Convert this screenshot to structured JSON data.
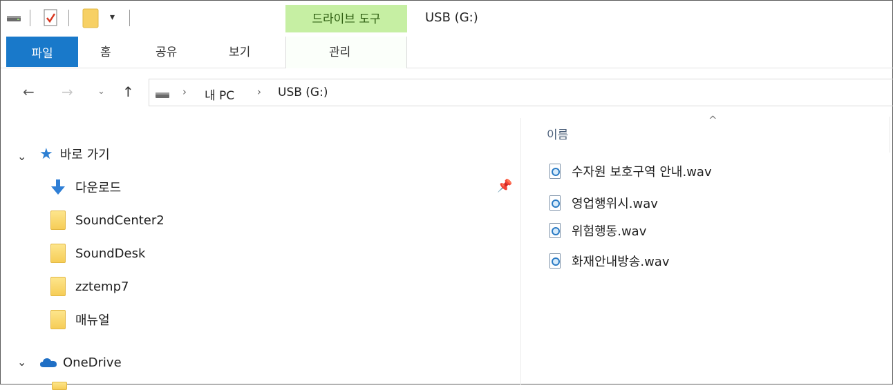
{
  "titlebar": {
    "context_tab_label": "드라이브 도구",
    "title": "USB (G:)",
    "quick_access": [
      "drive-icon",
      "properties-checkmark-icon",
      "new-folder-icon",
      "customize-dropdown-icon"
    ]
  },
  "ribbon": {
    "tabs": [
      {
        "label": "파일",
        "active": true
      },
      {
        "label": "홈"
      },
      {
        "label": "공유"
      },
      {
        "label": "보기"
      },
      {
        "label": "관리"
      }
    ],
    "accent": "#1979ca",
    "context_color": "#c6efa3"
  },
  "address": {
    "crumbs": [
      "내 PC",
      "USB (G:)"
    ],
    "sep": "›"
  },
  "nav": {
    "quick_access_label": "바로 가기",
    "items": [
      {
        "label": "다운로드",
        "icon": "download-arrow-icon"
      },
      {
        "label": "SoundCenter2",
        "icon": "folder-icon"
      },
      {
        "label": "SoundDesk",
        "icon": "folder-icon"
      },
      {
        "label": "zztemp7",
        "icon": "folder-icon"
      },
      {
        "label": "매뉴얼",
        "icon": "folder-icon"
      }
    ],
    "onedrive_label": "OneDrive"
  },
  "content": {
    "column_name": "이름",
    "files": [
      "수자원 보호구역 안내.wav",
      "영업행위시.wav",
      "위험행동.wav",
      "화재안내방송.wav"
    ]
  }
}
